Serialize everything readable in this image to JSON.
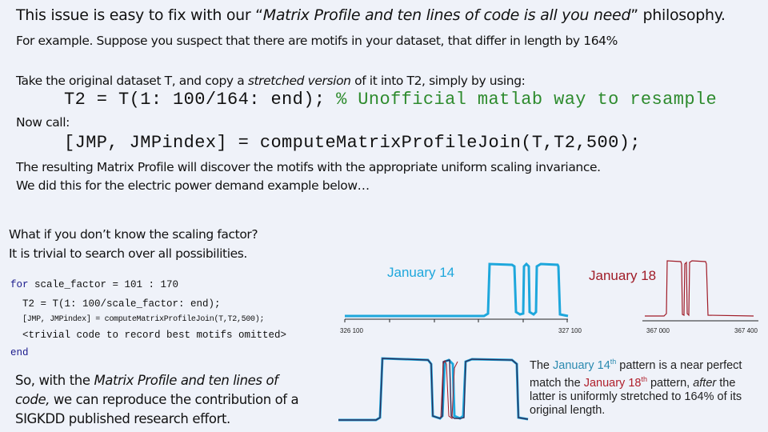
{
  "title": {
    "prefix": "This issue is easy to fix with our “",
    "italic": "Matrix Profile and ten lines of code is all you need",
    "suffix": "” philosophy."
  },
  "intro": "For example. Suppose you suspect that there are motifs in your dataset, that differ in length by 164%",
  "take": {
    "pre": "Take the original dataset T, and copy a ",
    "italic": "stretched version",
    "post": " of it into T2, simply by using:"
  },
  "code1": {
    "stmt": "T2 = T(1: 100/164: end);",
    "comment": "% Unofficial matlab way to resample"
  },
  "now_call": "Now call:",
  "code2": "[JMP, JMPindex] = computeMatrixProfileJoin(T,T2,500);",
  "result_lines": [
    "The resulting Matrix Profile will discover the motifs with the appropriate uniform scaling invariance.",
    "We did this for the electric power demand example below…"
  ],
  "question_lines": [
    "What if you don’t know the scaling factor?",
    "It is trivial to search over all possibilities."
  ],
  "loop_code": {
    "for_kw": "for",
    "for_rest": " scale_factor = 101 : 170",
    "line2": "T2 = T(1: 100/scale_factor: end);",
    "line3": "[JMP, JMPindex] = computeMatrixProfileJoin(T,T2,500);",
    "line4": "<trivial code to record best motifs omitted>",
    "end_kw": "end"
  },
  "conclusion": {
    "pre": "So, with the ",
    "italic": "Matrix Profile and ten lines of code,",
    "post": " we can reproduce the contribution of a SIGKDD published research effort."
  },
  "charts": {
    "jan14": {
      "label": "January 14",
      "color": "#1ea7dc",
      "ticks": [
        "326 100",
        "327 100"
      ]
    },
    "jan18": {
      "label": "January 18",
      "color": "#a01c28",
      "ticks": [
        "367 000",
        "367 400"
      ]
    }
  },
  "caption": {
    "p1": "The ",
    "jan14": "January 14",
    "sup1": "th",
    "p2": " pattern is a near perfect match the ",
    "jan18": "January 18",
    "sup2": "th",
    "p3": " pattern, ",
    "italic": "after",
    "p4": " the latter is uniformly stretched to 164% of its original length."
  }
}
